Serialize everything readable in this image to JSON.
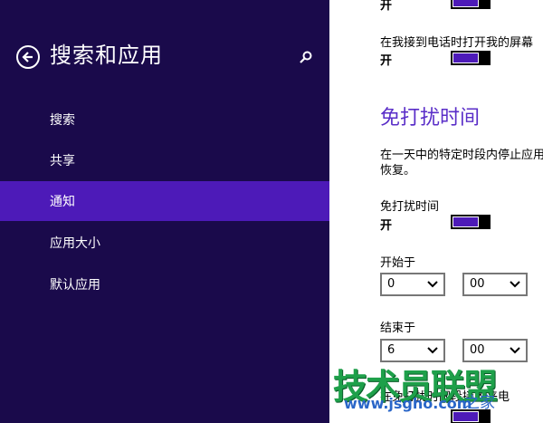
{
  "sidebar": {
    "title": "搜索和应用",
    "items": [
      {
        "label": "搜索"
      },
      {
        "label": "共享"
      },
      {
        "label": "通知"
      },
      {
        "label": "应用大小"
      },
      {
        "label": "默认应用"
      }
    ]
  },
  "main": {
    "top_toggle_state": "开",
    "screen_on_label": "在我接到电话时打开我的屏幕",
    "screen_on_state": "开",
    "quiet_hours_heading": "免打扰时间",
    "quiet_hours_desc_line1": "在一天中的特定时段内停止应用",
    "quiet_hours_desc_line2": "恢复。",
    "quiet_hours_label": "免打扰时间",
    "quiet_hours_state": "开",
    "start_label": "开始于",
    "start_hour": "0",
    "start_minute": "00",
    "end_label": "结束于",
    "end_hour": "6",
    "end_minute": "00",
    "bottom_partial_text": "在免打扰时间段接收来电"
  },
  "watermark": {
    "main": "技术员联盟",
    "url": "www.jsgho.com",
    "tail": "之家"
  }
}
